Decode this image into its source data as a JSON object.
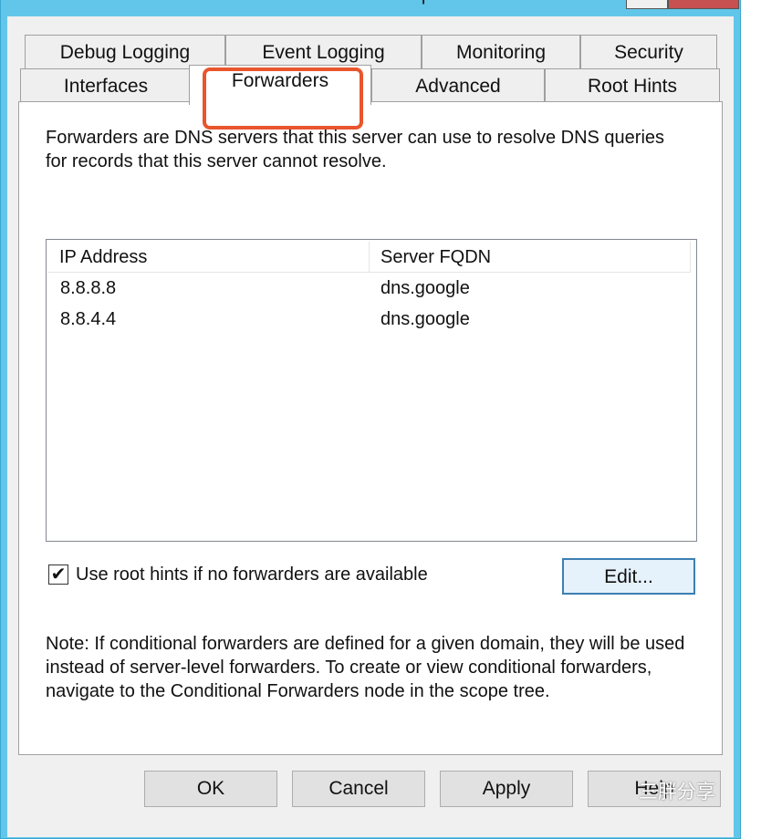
{
  "window": {
    "title": "ControlCenter Properties"
  },
  "tabs": {
    "row1": [
      "Debug Logging",
      "Event Logging",
      "Monitoring",
      "Security"
    ],
    "row2": [
      "Interfaces",
      "Forwarders",
      "Advanced",
      "Root Hints"
    ],
    "active": "Forwarders"
  },
  "description": "Forwarders are DNS servers that this server can use to resolve DNS queries for records that this server cannot resolve.",
  "table": {
    "columns": [
      "IP Address",
      "Server FQDN"
    ],
    "rows": [
      [
        "8.8.8.8",
        "dns.google"
      ],
      [
        "8.8.4.4",
        "dns.google"
      ]
    ]
  },
  "checkbox": {
    "label": "Use root hints if no forwarders are available",
    "checked": true
  },
  "edit_label": "Edit...",
  "note": "Note: If conditional forwarders are defined for a given domain, they will be used instead of server-level forwarders.  To create or view conditional forwarders, navigate to the Conditional Forwarders node in the scope tree.",
  "buttons": {
    "ok": "OK",
    "cancel": "Cancel",
    "apply": "Apply",
    "help": "Help"
  },
  "watermark": "三胖分享",
  "colors": {
    "highlight": "#e9552c",
    "frame": "#62c6ea"
  }
}
